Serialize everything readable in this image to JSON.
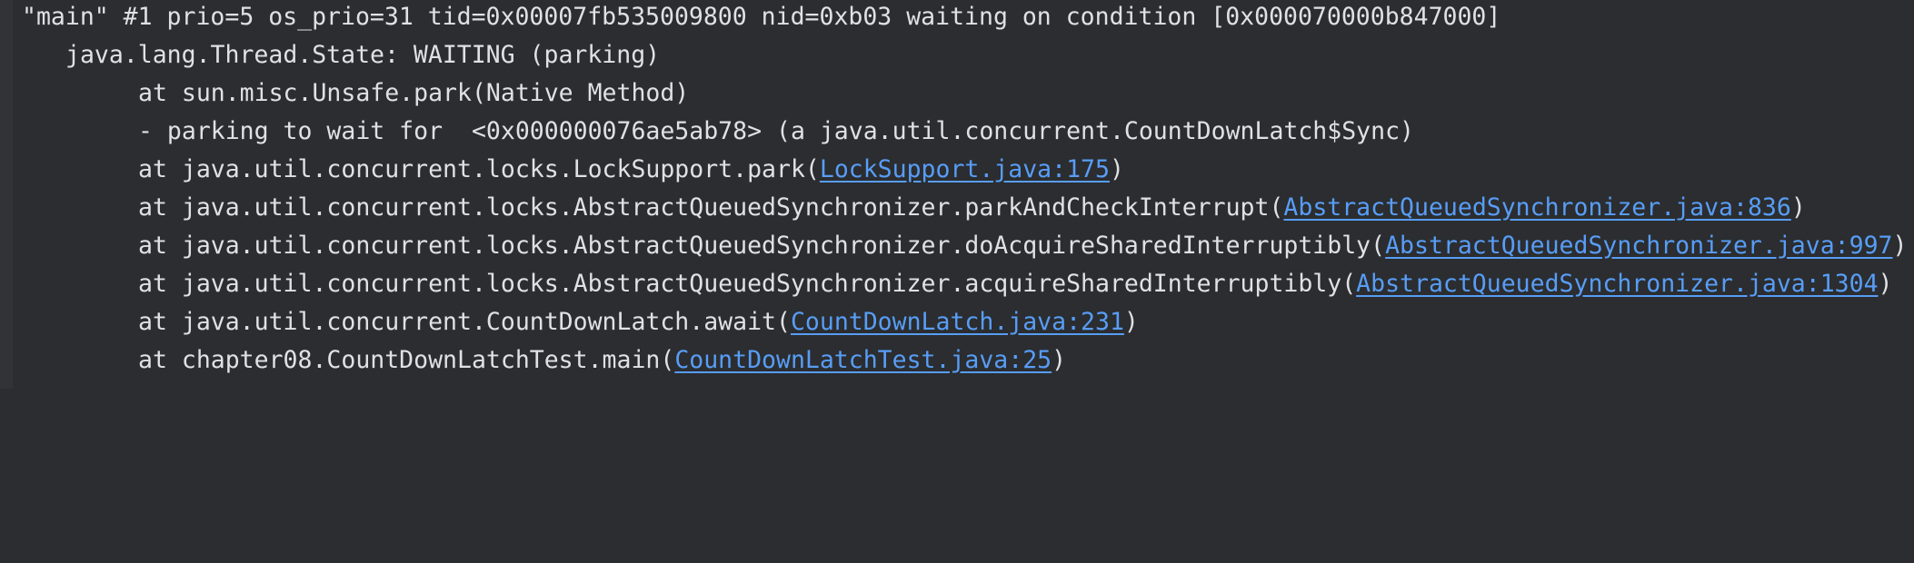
{
  "colors": {
    "background": "#2b2d30",
    "text": "#dfe1e5",
    "link": "#589df6"
  },
  "thread_dump": {
    "header": "\"main\" #1 prio=5 os_prio=31 tid=0x00007fb535009800 nid=0xb03 waiting on condition [0x000070000b847000]",
    "state": "java.lang.Thread.State: WAITING (parking)",
    "frames": [
      {
        "prefix": "at sun.misc.Unsafe.park(Native Method)"
      },
      {
        "prefix": "- parking to wait for  <0x000000076ae5ab78> (a java.util.concurrent.CountDownLatch$Sync)"
      },
      {
        "prefix": "at java.util.concurrent.locks.LockSupport.park(",
        "link": "LockSupport.java:175",
        "suffix": ")"
      },
      {
        "prefix": "at java.util.concurrent.locks.AbstractQueuedSynchronizer.parkAndCheckInterrupt(",
        "link": "AbstractQueuedSynchronizer.java:836",
        "suffix": ")"
      },
      {
        "prefix": "at java.util.concurrent.locks.AbstractQueuedSynchronizer.doAcquireSharedInterruptibly(",
        "link": "AbstractQueuedSynchronizer.java:997",
        "suffix": ")"
      },
      {
        "prefix": "at java.util.concurrent.locks.AbstractQueuedSynchronizer.acquireSharedInterruptibly(",
        "link": "AbstractQueuedSynchronizer.java:1304",
        "suffix": ")"
      },
      {
        "prefix": "at java.util.concurrent.CountDownLatch.await(",
        "link": "CountDownLatch.java:231",
        "suffix": ")"
      },
      {
        "prefix": "at chapter08.CountDownLatchTest.main(",
        "link": "CountDownLatchTest.java:25",
        "suffix": ")"
      }
    ]
  }
}
